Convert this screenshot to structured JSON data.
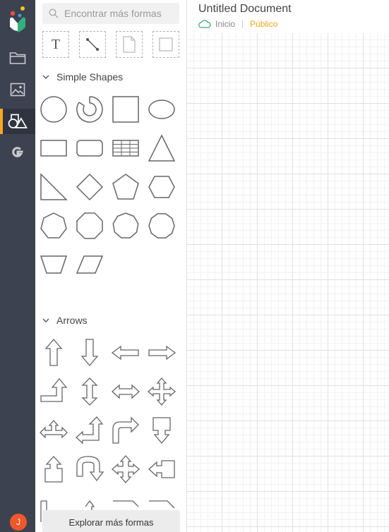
{
  "header": {
    "document_title": "Untitled Document",
    "breadcrumb_home": "Inicio",
    "visibility": "Público"
  },
  "rail": {
    "items": [
      {
        "name": "folder-icon"
      },
      {
        "name": "image-icon"
      },
      {
        "name": "shapes-icon",
        "active": true
      },
      {
        "name": "google-icon"
      }
    ],
    "avatar_initial": "J",
    "active_color": "#f7a823"
  },
  "panel": {
    "search_placeholder": "Encontrar más formas",
    "quick_tools": [
      "text-tool",
      "line-tool",
      "document-tool",
      "container-tool"
    ],
    "quick_text_glyph": "T",
    "sections": [
      {
        "label": "Simple Shapes",
        "shapes": [
          "circle",
          "ring",
          "square",
          "ellipse",
          "rectangle",
          "rounded-rectangle",
          "table",
          "triangle",
          "right-triangle",
          "diamond",
          "pentagon",
          "hexagon",
          "heptagon",
          "octagon",
          "nonagon",
          "decagon",
          "trapezoid",
          "parallelogram"
        ]
      },
      {
        "label": "Arrows",
        "shapes": [
          "arrow-up",
          "arrow-down",
          "arrow-left",
          "arrow-right",
          "arrow-turn-up",
          "arrow-up-down",
          "arrow-left-right",
          "arrow-quad",
          "arrow-tri-up",
          "arrow-corner-up-left",
          "arrow-curve-right",
          "arrow-callout-down",
          "arrow-callout-up",
          "arrow-u-turn",
          "arrow-quad-alt",
          "arrow-callout-left"
        ]
      }
    ],
    "explore_label": "Explorar más formas"
  },
  "colors": {
    "rail_bg": "#3c4250",
    "accent": "#f7a823",
    "public": "#f0a81a",
    "cloud": "#3aa76d"
  }
}
